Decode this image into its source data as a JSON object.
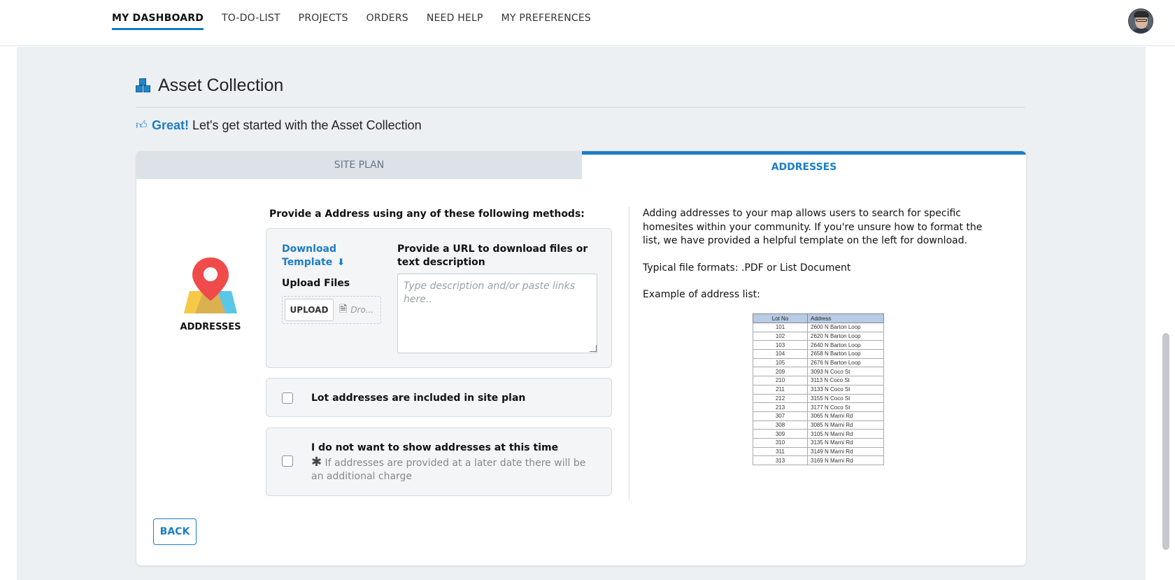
{
  "nav": {
    "items": [
      {
        "label": "MY DASHBOARD",
        "active": true
      },
      {
        "label": "TO-DO-LIST"
      },
      {
        "label": "PROJECTS"
      },
      {
        "label": "ORDERS"
      },
      {
        "label": "NEED HELP"
      },
      {
        "label": "MY PREFERENCES"
      }
    ]
  },
  "page": {
    "title": "Asset Collection",
    "subtitle_strong": "Great!",
    "subtitle_rest": "Let's get started with the Asset Collection"
  },
  "tabs": {
    "site_plan": "SITE PLAN",
    "addresses": "ADDRESSES"
  },
  "addresses": {
    "section_label": "ADDRESSES",
    "methods_heading": "Provide a Address using any of these following methods:",
    "download_template": "Download Template",
    "upload_files_label": "Upload Files",
    "upload_button": "UPLOAD",
    "drop_text": "Dro...",
    "url_label": "Provide a URL to download files or text description",
    "url_placeholder": "Type description and/or paste links here..",
    "option_included": "Lot addresses are included in site plan",
    "option_none": "I do not want to show addresses at this time",
    "option_none_note": "If addresses are provided at a later date there will be an additional charge"
  },
  "info": {
    "paragraph": "Adding addresses to your map allows users to search for specific homesites within your community. If you're unsure how to format the list, we have provided a helpful template on the left for download.",
    "formats": "Typical file formats: .PDF or List Document",
    "example_label": "Example of address list:"
  },
  "sample_table": {
    "headers": [
      "Lot No",
      "Address"
    ],
    "rows": [
      [
        "101",
        "2600 N Barton Loop"
      ],
      [
        "102",
        "2620 N Barton Loop"
      ],
      [
        "103",
        "2640 N Barton Loop"
      ],
      [
        "104",
        "2658 N Barton Loop"
      ],
      [
        "105",
        "2676 N Barton Loop"
      ],
      [
        "209",
        "3093 N Coco St"
      ],
      [
        "210",
        "3113 N Coco St"
      ],
      [
        "211",
        "3133 N Coco St"
      ],
      [
        "212",
        "3155 N Coco St"
      ],
      [
        "213",
        "3177 N Coco St"
      ],
      [
        "307",
        "3065 N Marni Rd"
      ],
      [
        "308",
        "3085 N Marni Rd"
      ],
      [
        "309",
        "3105 N Marni Rd"
      ],
      [
        "310",
        "3135 N Marni Rd"
      ],
      [
        "311",
        "3149 N Marni Rd"
      ],
      [
        "313",
        "3169 N Marni Rd"
      ]
    ]
  },
  "actions": {
    "back": "BACK"
  },
  "colors": {
    "accent": "#1c7dc6",
    "background": "#edf0f3"
  }
}
